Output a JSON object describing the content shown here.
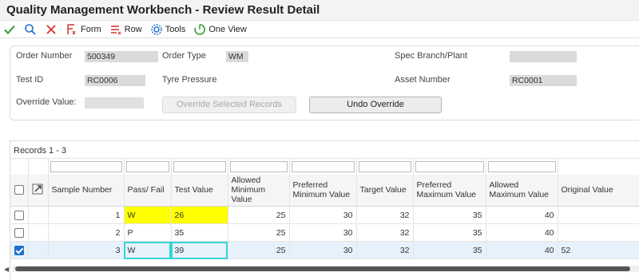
{
  "window": {
    "title": "Quality Management Workbench - Review Result Detail"
  },
  "toolbar": {
    "form_label": "Form",
    "row_label": "Row",
    "tools_label": "Tools",
    "one_view_label": "One View"
  },
  "form": {
    "order_number_label": "Order Number",
    "order_number_value": "500349",
    "order_type_label": "Order Type",
    "order_type_value": "WM",
    "spec_branch_label": "Spec Branch/Plant",
    "spec_branch_value": "",
    "test_id_label": "Test ID",
    "test_id_value": "RC0006",
    "test_desc": "Tyre Pressure",
    "asset_number_label": "Asset Number",
    "asset_number_value": "RC0001",
    "override_label": "Override Value:",
    "override_value": "",
    "override_selected_btn": "Override Selected Records",
    "undo_override_btn": "Undo Override"
  },
  "grid": {
    "records_label": "Records 1 - 3",
    "headers": {
      "sample_number": "Sample Number",
      "pass_fail": "Pass/ Fail",
      "test_value": "Test Value",
      "allowed_min": "Allowed Minimum Value",
      "preferred_min": "Preferred Minimum Value",
      "target_value": "Target Value",
      "preferred_max": "Preferred Maximum Value",
      "allowed_max": "Allowed Maximum Value",
      "original_value": "Original Value"
    },
    "rows": [
      {
        "sample": "1",
        "pass_fail": "W",
        "test_value": "26",
        "allowed_min": "25",
        "preferred_min": "30",
        "target": "32",
        "preferred_max": "35",
        "allowed_max": "40",
        "original": ""
      },
      {
        "sample": "2",
        "pass_fail": "P",
        "test_value": "35",
        "allowed_min": "25",
        "preferred_min": "30",
        "target": "32",
        "preferred_max": "35",
        "allowed_max": "40",
        "original": ""
      },
      {
        "sample": "3",
        "pass_fail": "W",
        "test_value": "39",
        "allowed_min": "25",
        "preferred_min": "30",
        "target": "32",
        "preferred_max": "35",
        "allowed_max": "40",
        "original": "52"
      }
    ]
  },
  "colors": {
    "accept": "#2e9b2e",
    "cancel": "#d9302c",
    "highlight": "#ffff00",
    "edit_outline": "#38d4d4",
    "selected_row": "#e6f1fb"
  }
}
